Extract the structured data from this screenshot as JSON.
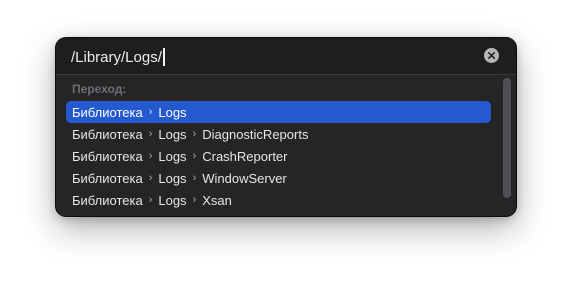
{
  "go_to_folder": {
    "path_value": "/Library/Logs/",
    "clear_icon": "xmark-circle-fill-icon",
    "section_label": "Переход:",
    "separator": "›",
    "suggestions": [
      [
        "Библиотека",
        "Logs"
      ],
      [
        "Библиотека",
        "Logs",
        "DiagnosticReports"
      ],
      [
        "Библиотека",
        "Logs",
        "CrashReporter"
      ],
      [
        "Библиотека",
        "Logs",
        "WindowServer"
      ],
      [
        "Библиотека",
        "Logs",
        "Xsan"
      ]
    ],
    "selected_index": 0
  },
  "colors": {
    "panel_background": "#1e1e1f",
    "selection": "#2459d0",
    "text": "#e6e6e6",
    "section_header": "#6e6e72"
  }
}
